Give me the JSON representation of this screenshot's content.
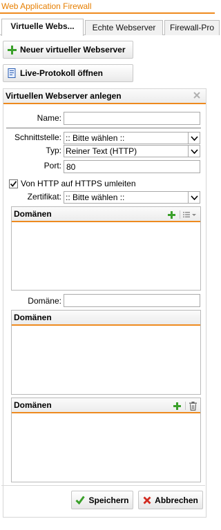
{
  "app": {
    "title": "Web Application Firewall"
  },
  "tabs": [
    {
      "label": "Virtuelle Webs..."
    },
    {
      "label": "Echte Webserver"
    },
    {
      "label": "Firewall-Pro"
    }
  ],
  "actions": {
    "new_label": "Neuer virtueller Webserver",
    "log_label": "Live-Protokoll öffnen"
  },
  "dialog": {
    "title": "Virtuellen Webserver anlegen",
    "name_label": "Name:",
    "name_value": "",
    "interface_label": "Schnittstelle:",
    "interface_value": ":: Bitte wählen ::",
    "type_label": "Typ:",
    "type_value": "Reiner Text (HTTP)",
    "port_label": "Port:",
    "port_value": "80",
    "redirect_label": "Von HTTP auf HTTPS umleiten",
    "redirect_checked": true,
    "cert_label": "Zertifikat:",
    "cert_value": ":: Bitte wählen ::",
    "domains_grid1_title": "Domänen",
    "domain_label": "Domäne:",
    "domain_value": "",
    "domains_grid2_title": "Domänen",
    "domains_grid3_title": "Domänen",
    "save_label": "Speichern",
    "cancel_label": "Abbrechen"
  },
  "colors": {
    "accent": "#ee8a1e",
    "title_text": "#e67e00",
    "add_green": "#3aa02a",
    "cancel_red": "#d22a1f"
  },
  "icons": {
    "new": "plus-icon",
    "log": "log-document-icon",
    "close": "close-icon",
    "grid_add": "plus-icon",
    "grid_menu": "list-menu-icon",
    "grid_delete": "trash-icon",
    "save": "check-icon",
    "cancel": "x-icon"
  }
}
